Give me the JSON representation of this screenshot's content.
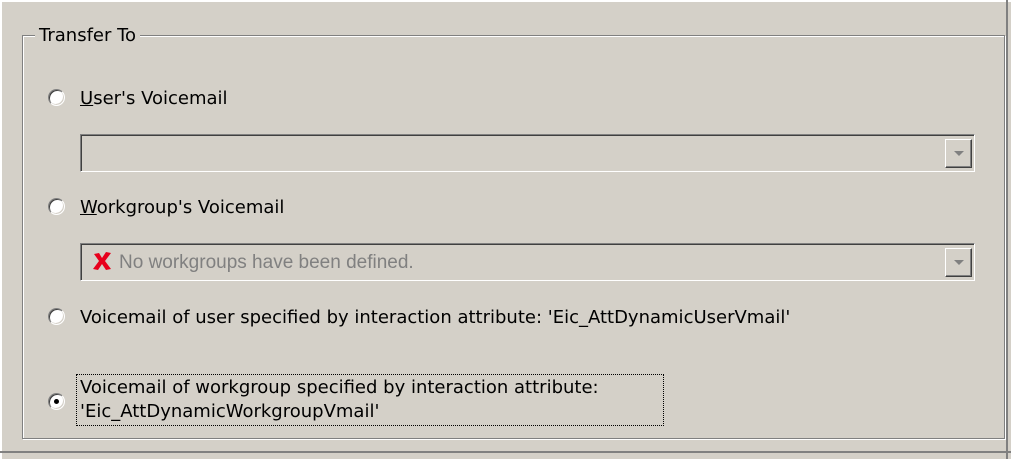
{
  "groupbox": {
    "title": "Transfer To"
  },
  "options": [
    {
      "label_mnemonic": "U",
      "label_rest": "ser's Voicemail",
      "selected": false
    },
    {
      "label_mnemonic": "W",
      "label_rest": "orkgroup's Voicemail",
      "selected": false
    },
    {
      "label": "Voicemail of user specified by interaction attribute: 'Eic_AttDynamicUserVmail'",
      "selected": false
    },
    {
      "label_line1": "Voicemail of workgroup specified by interaction attribute:",
      "label_line2": "'Eic_AttDynamicWorkgroupVmail'",
      "selected": true
    }
  ],
  "user_voicemail_combo": {
    "value": "",
    "enabled": false
  },
  "workgroup_voicemail_combo": {
    "value": "No workgroups have been defined.",
    "icon": "error-x-icon",
    "icon_color": "#e8001c",
    "enabled": false
  }
}
